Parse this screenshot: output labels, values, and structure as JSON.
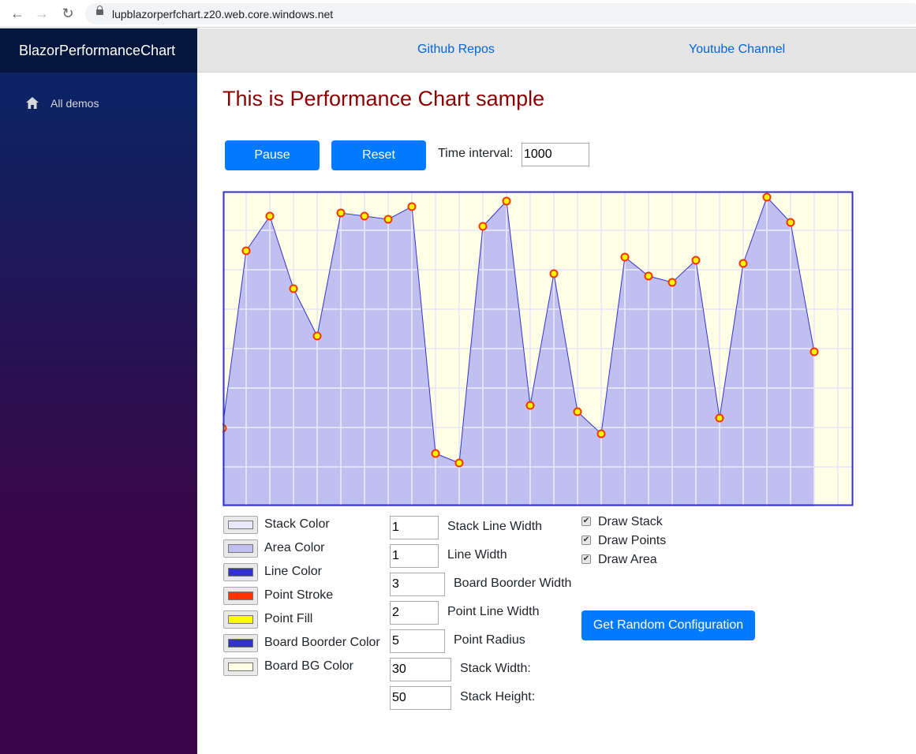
{
  "browser": {
    "url": "lupblazorperfchart.z20.web.core.windows.net"
  },
  "sidebar": {
    "brand": "BlazorPerformanceChart",
    "items": [
      {
        "label": "All demos",
        "icon": "home-icon"
      }
    ]
  },
  "top_links": [
    {
      "label": "Github Repos"
    },
    {
      "label": "Youtube Channel"
    }
  ],
  "main": {
    "title": "This is Performance Chart sample",
    "pause_label": "Pause",
    "reset_label": "Reset",
    "time_interval_label": "Time interval:",
    "time_interval_value": "1000"
  },
  "colors": {
    "stack": "#e8e8fc",
    "area": "#c0c0f0",
    "line": "#3333cc",
    "point_stroke": "#ff3300",
    "point_fill": "#ffff00",
    "board_border": "#3333cc",
    "board_bg": "#ffffe6",
    "title": "#8b0000",
    "primary": "#007bff",
    "link": "#0366d6"
  },
  "color_settings": [
    {
      "label": "Stack Color",
      "key": "stack"
    },
    {
      "label": "Area Color",
      "key": "area"
    },
    {
      "label": "Line Color",
      "key": "line"
    },
    {
      "label": "Point Stroke",
      "key": "point_stroke"
    },
    {
      "label": "Point Fill",
      "key": "point_fill"
    },
    {
      "label": "Board Boorder Color",
      "key": "board_border"
    },
    {
      "label": "Board BG Color",
      "key": "board_bg"
    }
  ],
  "numeric_settings": [
    {
      "label": "Stack Line Width",
      "value": "1"
    },
    {
      "label": "Line Width",
      "value": "1"
    },
    {
      "label": "Board Boorder Width",
      "value": "3"
    },
    {
      "label": "Point Line Width",
      "value": "2"
    },
    {
      "label": "Point Radius",
      "value": "5"
    },
    {
      "label": "Stack Width:",
      "value": "30"
    },
    {
      "label": "Stack Height:",
      "value": "50"
    }
  ],
  "checkboxes": [
    {
      "label": "Draw Stack",
      "checked": true
    },
    {
      "label": "Draw Points",
      "checked": true
    },
    {
      "label": "Draw Area",
      "checked": true
    }
  ],
  "random_config_label": "Get Random Configuration",
  "chart_data": {
    "type": "area",
    "title": "",
    "xlabel": "",
    "ylabel": "",
    "x": [
      0,
      1,
      2,
      3,
      4,
      5,
      6,
      7,
      8,
      9,
      10,
      11,
      12,
      13,
      14,
      15,
      16,
      17,
      18,
      19,
      20,
      21,
      22,
      23,
      24,
      25
    ],
    "values": [
      99,
      324,
      368,
      276,
      216,
      372,
      368,
      364,
      380,
      67,
      55,
      355,
      387,
      128,
      295,
      120,
      92,
      316,
      292,
      284,
      312,
      112,
      308,
      392,
      360,
      196
    ],
    "ylim": [
      0,
      400
    ],
    "x_capacity": 27,
    "grid": true,
    "legend": "none",
    "stack_width": 30,
    "stack_height": 50,
    "draw_stack": true,
    "draw_points": true,
    "draw_area": true
  }
}
